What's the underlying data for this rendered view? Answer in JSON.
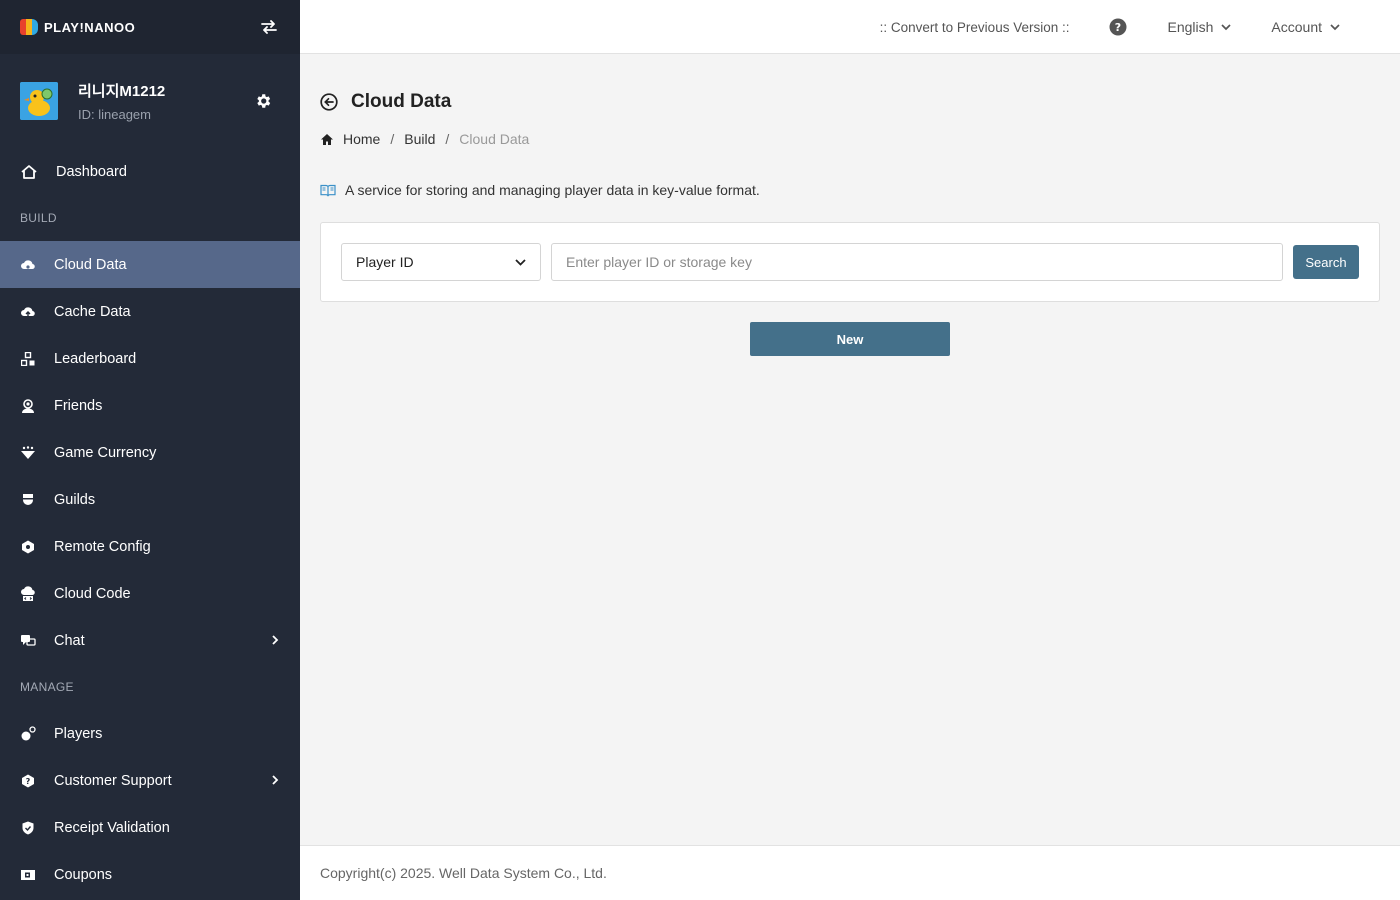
{
  "brand": {
    "logo_text": "PLAY!NANOO"
  },
  "profile": {
    "name": "리니지M1212",
    "id": "ID: lineagem"
  },
  "nav": {
    "dashboard": "Dashboard",
    "section_build": "BUILD",
    "build_items": [
      {
        "label": "Cloud Data",
        "icon": "cloud-gear-icon",
        "active": true
      },
      {
        "label": "Cache Data",
        "icon": "cloud-upload-icon"
      },
      {
        "label": "Leaderboard",
        "icon": "leaderboard-icon"
      },
      {
        "label": "Friends",
        "icon": "friends-icon"
      },
      {
        "label": "Game Currency",
        "icon": "currency-icon"
      },
      {
        "label": "Guilds",
        "icon": "guild-icon"
      },
      {
        "label": "Remote Config",
        "icon": "remote-config-icon"
      },
      {
        "label": "Cloud Code",
        "icon": "cloud-code-icon"
      },
      {
        "label": "Chat",
        "icon": "chat-icon",
        "has_children": true
      }
    ],
    "section_manage": "MANAGE",
    "manage_items": [
      {
        "label": "Players",
        "icon": "players-icon"
      },
      {
        "label": "Customer Support",
        "icon": "support-icon",
        "has_children": true
      },
      {
        "label": "Receipt Validation",
        "icon": "shield-check-icon"
      },
      {
        "label": "Coupons",
        "icon": "coupon-icon"
      }
    ]
  },
  "header": {
    "convert_link": ":: Convert to Previous Version ::",
    "language": "English",
    "account": "Account"
  },
  "page": {
    "title": "Cloud Data",
    "breadcrumb": {
      "home": "Home",
      "build": "Build",
      "current": "Cloud Data",
      "separator": "/"
    },
    "description": "A service for storing and managing player data in key-value format."
  },
  "search": {
    "select_value": "Player ID",
    "placeholder": "Enter player ID or storage key",
    "button": "Search"
  },
  "actions": {
    "new_button": "New"
  },
  "footer": {
    "copyright": "Copyright(c) 2025. Well Data System Co., Ltd."
  },
  "colors": {
    "sidebar_bg": "#232a38",
    "active_bg": "#56688a",
    "primary_button": "#44708a"
  }
}
